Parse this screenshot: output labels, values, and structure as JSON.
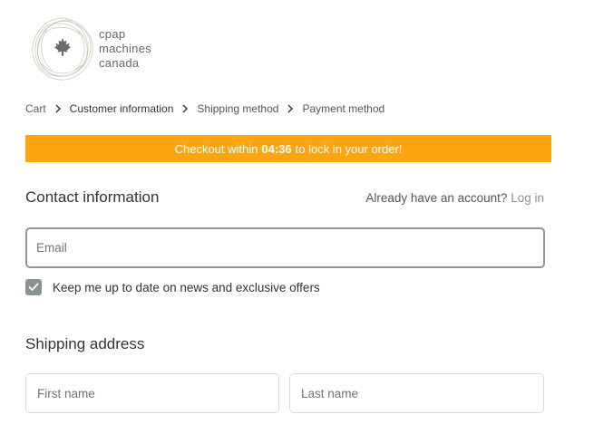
{
  "logo": {
    "lines": [
      "cpap",
      "machines",
      "canada"
    ]
  },
  "breadcrumb": {
    "items": [
      {
        "label": "Cart"
      },
      {
        "label": "Customer information"
      },
      {
        "label": "Shipping method"
      },
      {
        "label": "Payment method"
      }
    ]
  },
  "banner": {
    "prefix": "Checkout within",
    "timer": "04:36",
    "suffix": "to lock in your order!",
    "color": "#fba60e"
  },
  "contact": {
    "title": "Contact information",
    "account_prompt": "Already have an account?",
    "login_label": "Log in",
    "email_placeholder": "Email",
    "email_value": "",
    "marketing_label": "Keep me up to date on news and exclusive offers",
    "marketing_checked": true
  },
  "shipping": {
    "title": "Shipping address",
    "first_name_placeholder": "First name",
    "last_name_placeholder": "Last name"
  },
  "icons": {
    "logo": "maple-leaf-logo-icon",
    "breadcrumb_separator": "chevron-right-icon",
    "checkbox": "checkmark-icon"
  }
}
